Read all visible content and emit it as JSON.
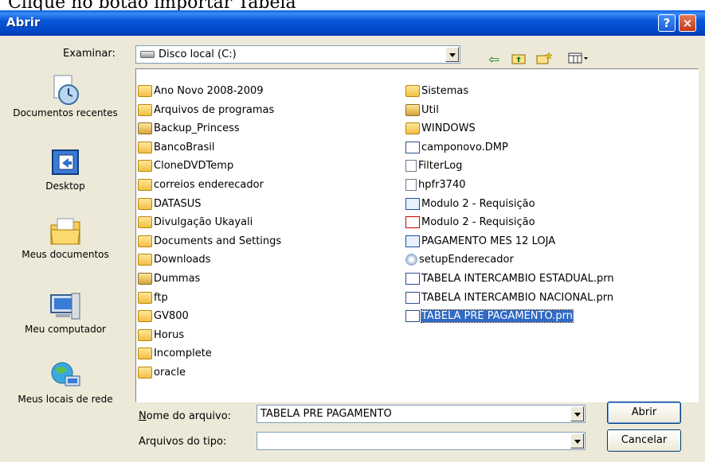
{
  "caption": "Clique no botão importar Tabela",
  "window": {
    "title": "Abrir",
    "help_label": "?",
    "close_label": "×"
  },
  "toolbar": {
    "look_in_label": "Examinar:",
    "look_in_value": "Disco local (C:)"
  },
  "places": [
    {
      "label": "Documentos recentes",
      "icon": "recent-documents-icon"
    },
    {
      "label": "Desktop",
      "icon": "desktop-icon"
    },
    {
      "label": "Meus documentos",
      "icon": "my-documents-icon"
    },
    {
      "label": "Meu computador",
      "icon": "my-computer-icon"
    },
    {
      "label": "Meus locais de rede",
      "icon": "network-places-icon"
    }
  ],
  "files": {
    "column1": [
      {
        "name": "Ano Novo 2008-2009",
        "icon": "folder"
      },
      {
        "name": "Arquivos de programas",
        "icon": "folder"
      },
      {
        "name": "Backup_Princess",
        "icon": "folder-shared"
      },
      {
        "name": "BancoBrasil",
        "icon": "folder"
      },
      {
        "name": "CloneDVDTemp",
        "icon": "folder"
      },
      {
        "name": "correios enderecador",
        "icon": "folder"
      },
      {
        "name": "DATASUS",
        "icon": "folder"
      },
      {
        "name": "Divulgação Ukayali",
        "icon": "folder"
      },
      {
        "name": "Documents and Settings",
        "icon": "folder"
      },
      {
        "name": "Downloads",
        "icon": "folder"
      },
      {
        "name": "Dummas",
        "icon": "folder-shared"
      },
      {
        "name": "ftp",
        "icon": "folder"
      },
      {
        "name": "GV800",
        "icon": "folder"
      },
      {
        "name": "Horus",
        "icon": "folder"
      },
      {
        "name": "Incomplete",
        "icon": "folder"
      },
      {
        "name": "oracle",
        "icon": "folder"
      }
    ],
    "column2": [
      {
        "name": "Sistemas",
        "icon": "folder"
      },
      {
        "name": "Util",
        "icon": "folder-shared"
      },
      {
        "name": "WINDOWS",
        "icon": "folder"
      },
      {
        "name": "camponovo.DMP",
        "icon": "file-table"
      },
      {
        "name": "FilterLog",
        "icon": "file-text"
      },
      {
        "name": "hpfr3740",
        "icon": "file-text"
      },
      {
        "name": "Modulo 2 - Requisição",
        "icon": "word-doc"
      },
      {
        "name": "Modulo 2 - Requisição",
        "icon": "pdf-doc"
      },
      {
        "name": "PAGAMENTO MES 12 LOJA",
        "icon": "word-doc"
      },
      {
        "name": "setupEnderecador",
        "icon": "installer"
      },
      {
        "name": "TABELA INTERCAMBIO ESTADUAL.prn",
        "icon": "file-table"
      },
      {
        "name": "TABELA INTERCAMBIO NACIONAL.prn",
        "icon": "file-table"
      },
      {
        "name": "TABELA PRE PAGAMENTO.prn",
        "icon": "file-table",
        "selected": true
      }
    ]
  },
  "filename": {
    "label": "Nome do arquivo:",
    "value": "TABELA PRE PAGAMENTO"
  },
  "filetype": {
    "label": "Arquivos do tipo:",
    "value": ""
  },
  "buttons": {
    "open": "Abrir",
    "cancel": "Cancelar"
  }
}
